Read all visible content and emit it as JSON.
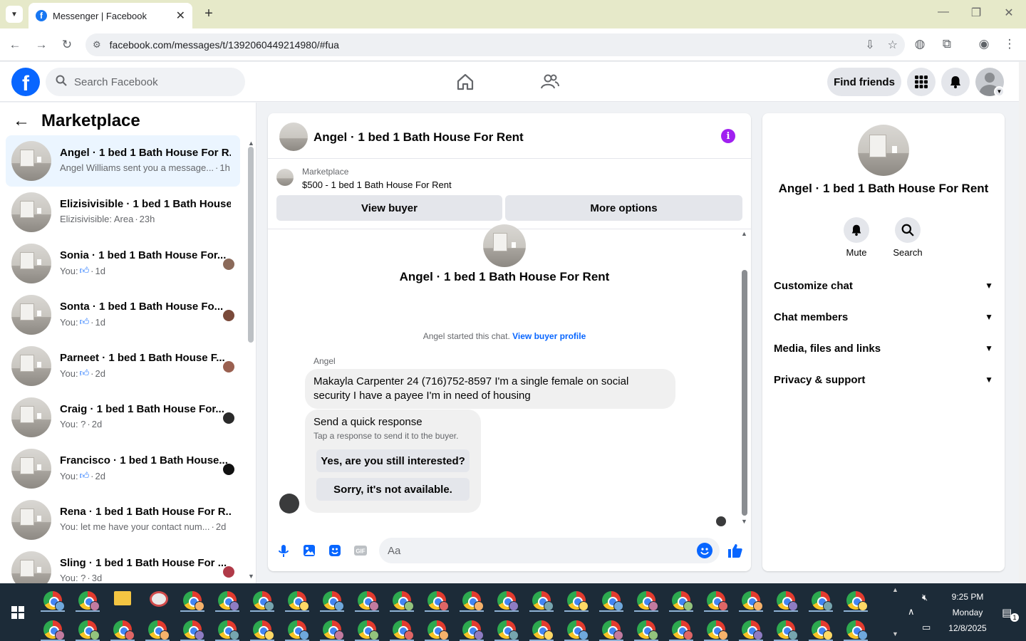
{
  "browser": {
    "tab_title": "Messenger | Facebook",
    "url": "facebook.com/messages/t/1392060449214980/#fua"
  },
  "fb_header": {
    "search_placeholder": "Search Facebook",
    "find_friends": "Find friends"
  },
  "sidebar": {
    "title": "Marketplace",
    "conversations": [
      {
        "name": "Angel · 1 bed 1 Bath House For R...",
        "preview": "Angel Williams sent you a message...",
        "time": "1h",
        "active": true,
        "you_like": false,
        "avatar_color": ""
      },
      {
        "name": "Elizisivisible · 1 bed 1 Bath House...",
        "preview": "Elizisivisible: Area",
        "time": "23h",
        "active": false,
        "you_like": false,
        "avatar_color": ""
      },
      {
        "name": "Sonia · 1 bed 1 Bath House For...",
        "preview": "You:",
        "time": "1d",
        "active": false,
        "you_like": true,
        "avatar_color": "#8b6a5a"
      },
      {
        "name": "Sonta · 1 bed 1 Bath House Fo...",
        "preview": "You:",
        "time": "1d",
        "active": false,
        "you_like": true,
        "avatar_color": "#7a4a3a"
      },
      {
        "name": "Parneet · 1 bed 1 Bath House F...",
        "preview": "You:",
        "time": "2d",
        "active": false,
        "you_like": true,
        "avatar_color": "#9a6050"
      },
      {
        "name": "Craig · 1 bed 1 Bath House For...",
        "preview": "You: ?",
        "time": "2d",
        "active": false,
        "you_like": false,
        "avatar_color": "#2a2a2a"
      },
      {
        "name": "Francisco · 1 bed 1 Bath House...",
        "preview": "You:",
        "time": "2d",
        "active": false,
        "you_like": true,
        "avatar_color": "#111111"
      },
      {
        "name": "Rena · 1 bed 1 Bath House For R...",
        "preview": "You: let me have your contact num...",
        "time": "2d",
        "active": false,
        "you_like": false,
        "avatar_color": ""
      },
      {
        "name": "Sling · 1 bed 1 Bath House For ...",
        "preview": "You: ?",
        "time": "3d",
        "active": false,
        "you_like": false,
        "avatar_color": "#b03a48"
      }
    ]
  },
  "chat": {
    "title": "Angel · 1 bed 1 Bath House For Rent",
    "marketplace_label": "Marketplace",
    "listing": "$500 - 1 bed 1 Bath House For Rent",
    "view_buyer": "View buyer",
    "more_options": "More options",
    "hero_title": "Angel · 1 bed 1 Bath House For Rent",
    "started_text": "Angel started this chat.",
    "view_buyer_profile": "View buyer profile",
    "sender_name": "Angel",
    "message": "Makayla Carpenter 24 (716)752-8597 I'm a single female on social security I have a payee I'm in need of housing",
    "quick_title": "Send a quick response",
    "quick_sub": "Tap a response to send it to the buyer.",
    "quick_1": "Yes, are you still interested?",
    "quick_2": "Sorry, it's not available.",
    "composer_placeholder": "Aa"
  },
  "info_panel": {
    "title": "Angel · 1 bed 1 Bath House For Rent",
    "mute": "Mute",
    "search": "Search",
    "rows": [
      "Customize chat",
      "Chat members",
      "Media, files and links",
      "Privacy & support"
    ]
  },
  "taskbar": {
    "time": "9:25 PM",
    "day": "Monday",
    "date": "12/8/2025",
    "notifications": "1"
  }
}
